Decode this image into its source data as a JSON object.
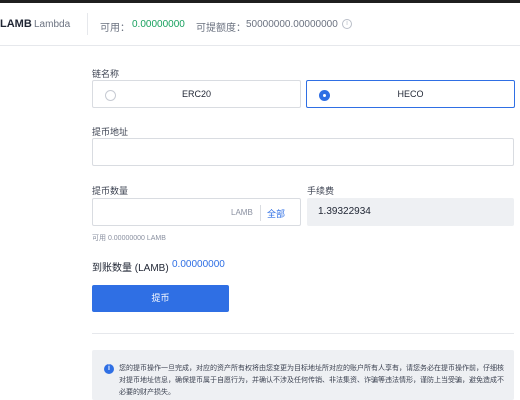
{
  "header": {
    "asset_symbol": "LAMB",
    "asset_name": "Lambda",
    "available_label": "可用：",
    "available_value": "0.00000000",
    "limit_label": "可提额度：",
    "limit_value": "50000000.00000000",
    "info_icon": "info-circle-icon"
  },
  "form": {
    "chain_label": "链名称",
    "chains": [
      {
        "label": "ERC20",
        "selected": false
      },
      {
        "label": "HECO",
        "selected": true
      }
    ],
    "address_label": "提币地址",
    "address_value": "",
    "amount_label": "提币数量",
    "amount_value": "",
    "amount_unit": "LAMB",
    "all_label": "全部",
    "fee_label": "手续费",
    "fee_value": "1.39322934",
    "available_hint": "可用 0.00000000 LAMB",
    "receive_label": "到账数量 (LAMB)",
    "receive_value": "0.00000000",
    "submit_label": "提币"
  },
  "notice": {
    "icon": "info-icon",
    "text": "您的提币操作一旦完成，对应的资产所有权将由您变更为目标地址所对应的账户所有人享有，请您务必在提币操作前，仔细核对提币地址信息，确保提币属于自愿行为，并确认不涉及任何传销、非法集资、诈骗等违法情形，谨防上当受骗，避免造成不必要的财产损失。"
  },
  "colors": {
    "accent": "#2f6fe4",
    "available_green": "#19a15f",
    "border": "#d9dce1",
    "muted_bg": "#eef0f3"
  }
}
